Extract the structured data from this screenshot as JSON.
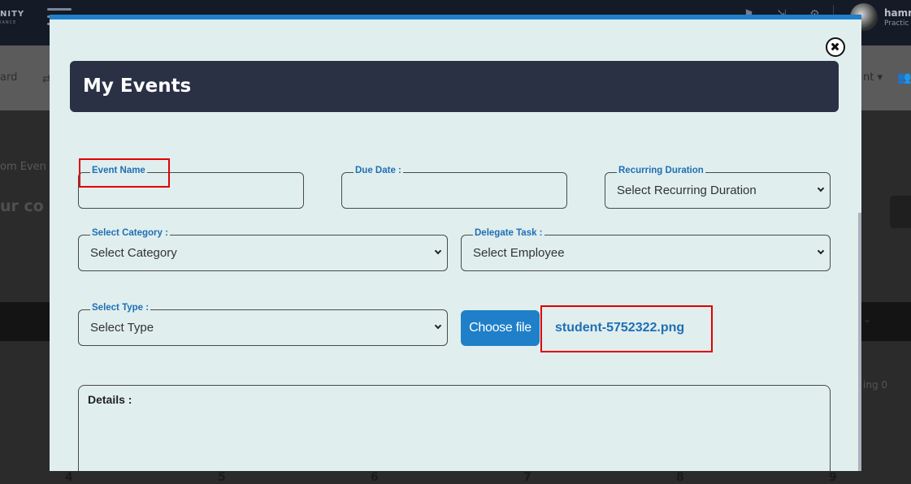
{
  "background": {
    "logo_text": "NITY",
    "logo_sub": "IANCE",
    "user_name": "hamn",
    "user_role": "Practic",
    "top_icons": "⚑ ⇲ ⚙",
    "nav_left_text": "ard",
    "nav_left_icon": "⇄",
    "nav_right_text": "nt ▾",
    "nav_people_icon": "👥",
    "breadcrumb": "om Even",
    "heading": "ur co",
    "band_caret": "⌄",
    "side_text": "ing 0",
    "calendar_days": [
      "4",
      "5",
      "6",
      "7",
      "8",
      "9"
    ]
  },
  "modal": {
    "title": "My Events",
    "close_icon": "close-circle",
    "fields": {
      "event_name": {
        "label": "Event Name",
        "value": ""
      },
      "due_date": {
        "label": "Due Date :",
        "value": ""
      },
      "recurring_duration": {
        "label": "Recurring Duration",
        "value": "Select Recurring Duration"
      },
      "category": {
        "label": "Select Category :",
        "value": "Select Category"
      },
      "delegate_task": {
        "label": "Delegate Task :",
        "value": "Select Employee"
      },
      "type": {
        "label": "Select Type :",
        "value": "Select Type"
      }
    },
    "file": {
      "button_label": "Choose file",
      "file_name": "student-5752322.png"
    },
    "details_label": "Details :"
  },
  "colors": {
    "modal_bg": "#e0eeee",
    "header_bg": "#2a3145",
    "accent": "#1f7fc8",
    "label_blue": "#1f6fb4",
    "highlight_red": "#e00000"
  }
}
